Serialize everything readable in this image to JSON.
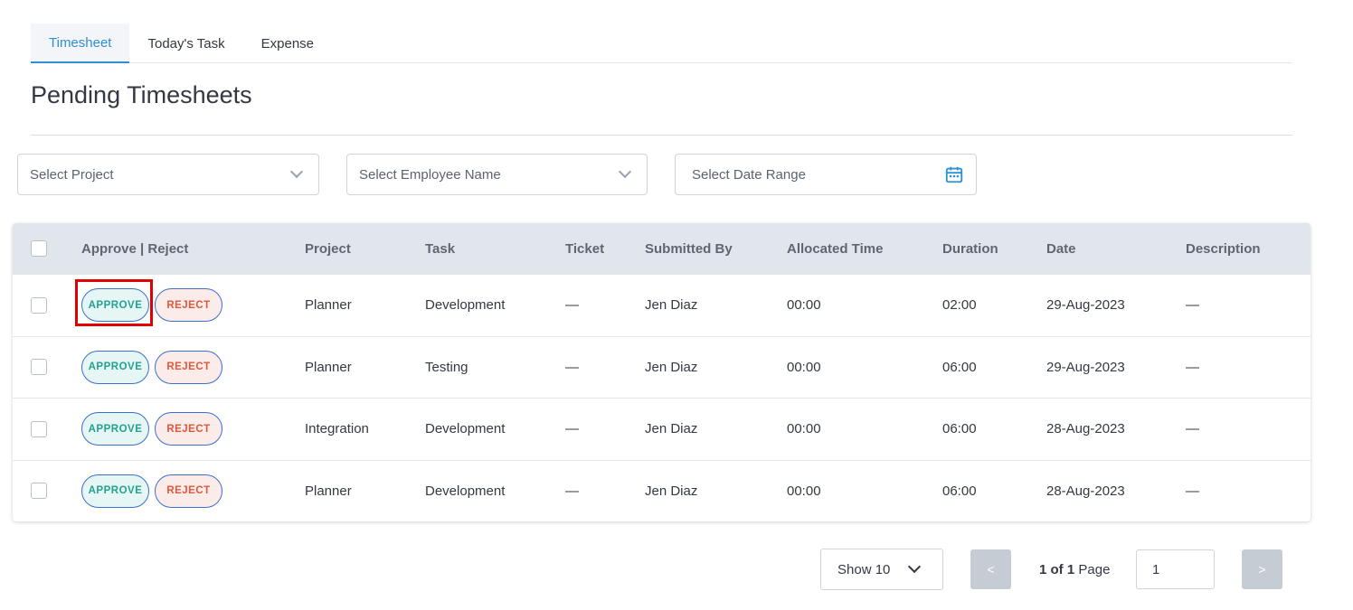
{
  "tabs": [
    {
      "label": "Timesheet",
      "active": true
    },
    {
      "label": "Today's Task",
      "active": false
    },
    {
      "label": "Expense",
      "active": false
    }
  ],
  "page_title": "Pending Timesheets",
  "filters": {
    "project_placeholder": "Select Project",
    "employee_placeholder": "Select Employee Name",
    "date_placeholder": "Select Date Range"
  },
  "table": {
    "headers": {
      "actions": "Approve | Reject",
      "project": "Project",
      "task": "Task",
      "ticket": "Ticket",
      "submitted_by": "Submitted By",
      "allocated_time": "Allocated Time",
      "duration": "Duration",
      "date": "Date",
      "description": "Description"
    },
    "approve_label": "APPROVE",
    "reject_label": "REJECT",
    "rows": [
      {
        "project": "Planner",
        "task": "Development",
        "ticket": "—",
        "submitted_by": "Jen Diaz",
        "allocated_time": "00:00",
        "duration": "02:00",
        "date": "29-Aug-2023",
        "description": "—"
      },
      {
        "project": "Planner",
        "task": "Testing",
        "ticket": "—",
        "submitted_by": "Jen Diaz",
        "allocated_time": "00:00",
        "duration": "06:00",
        "date": "29-Aug-2023",
        "description": "—"
      },
      {
        "project": "Integration",
        "task": "Development",
        "ticket": "—",
        "submitted_by": "Jen Diaz",
        "allocated_time": "00:00",
        "duration": "06:00",
        "date": "28-Aug-2023",
        "description": "—"
      },
      {
        "project": "Planner",
        "task": "Development",
        "ticket": "—",
        "submitted_by": "Jen Diaz",
        "allocated_time": "00:00",
        "duration": "06:00",
        "date": "28-Aug-2023",
        "description": "—"
      }
    ]
  },
  "pagination": {
    "show_label": "Show 10",
    "prev_label": "<",
    "next_label": ">",
    "current_page": "1",
    "of_text": "of",
    "total_pages": "1",
    "page_word": "Page",
    "page_input_value": "1"
  },
  "colors": {
    "accent": "#2d8fd5",
    "approve_text": "#22a290",
    "reject_text": "#e0573b",
    "highlight": "#e00000"
  }
}
